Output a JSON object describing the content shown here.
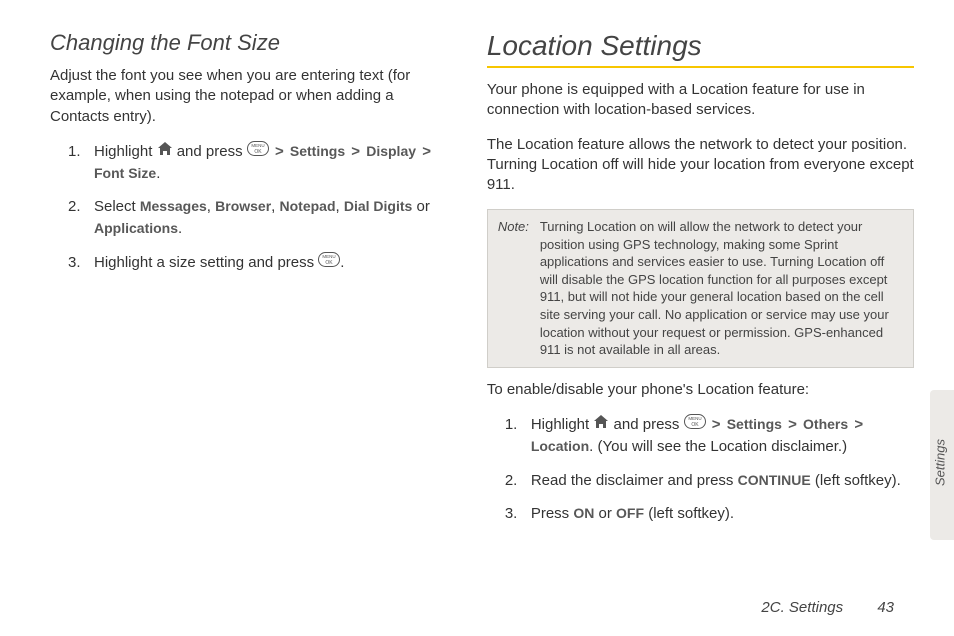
{
  "left": {
    "heading": "Changing the Font Size",
    "intro": "Adjust the font you see when you are entering text (for example, when using the notepad or when adding a Contacts entry).",
    "step1_a": "Highlight ",
    "step1_b": " and press ",
    "step1_settings": "Settings",
    "step1_display": "Display",
    "step1_fontsize": "Font Size",
    "step1_period": ".",
    "step2_a": "Select ",
    "step2_messages": "Messages",
    "step2_sep1": ", ",
    "step2_browser": "Browser",
    "step2_sep2": ", ",
    "step2_notepad": "Notepad",
    "step2_sep3": ", ",
    "step2_dialdigits": "Dial Digits",
    "step2_or": " or ",
    "step2_applications": "Applications",
    "step2_period": ".",
    "step3_a": "Highlight a size setting and press ",
    "step3_period": "."
  },
  "right": {
    "heading": "Location Settings",
    "intro1": "Your phone is equipped with a Location feature for use in connection with location-based services.",
    "intro2": "The Location feature allows the network to detect your position. Turning Location off will hide your location from everyone except 911.",
    "note_label": "Note:",
    "note_text": "Turning Location on will allow the network to detect your position using GPS technology, making some Sprint applications and services easier to use. Turning Location off will disable the GPS location function for all purposes except 911, but will not hide your general location based on the cell site serving your call. No application or service may use your location without your request or permission. GPS-enhanced 911 is not available in all areas.",
    "enable_line": "To enable/disable your phone's Location feature:",
    "step1_a": "Highlight ",
    "step1_b": " and press ",
    "step1_settings": "Settings",
    "step1_others": "Others",
    "step1_location": "Location",
    "step1_tail": ". (You will see the Location disclaimer.)",
    "step2_a": "Read the disclaimer and press ",
    "step2_continue": "CONTINUE",
    "step2_tail": " (left softkey).",
    "step3_a": "Press ",
    "step3_on": "ON",
    "step3_or": " or ",
    "step3_off": "OFF",
    "step3_tail": " (left softkey)."
  },
  "sidetab": "Settings",
  "footer_section": "2C. Settings",
  "footer_page": "43",
  "gt": ">"
}
